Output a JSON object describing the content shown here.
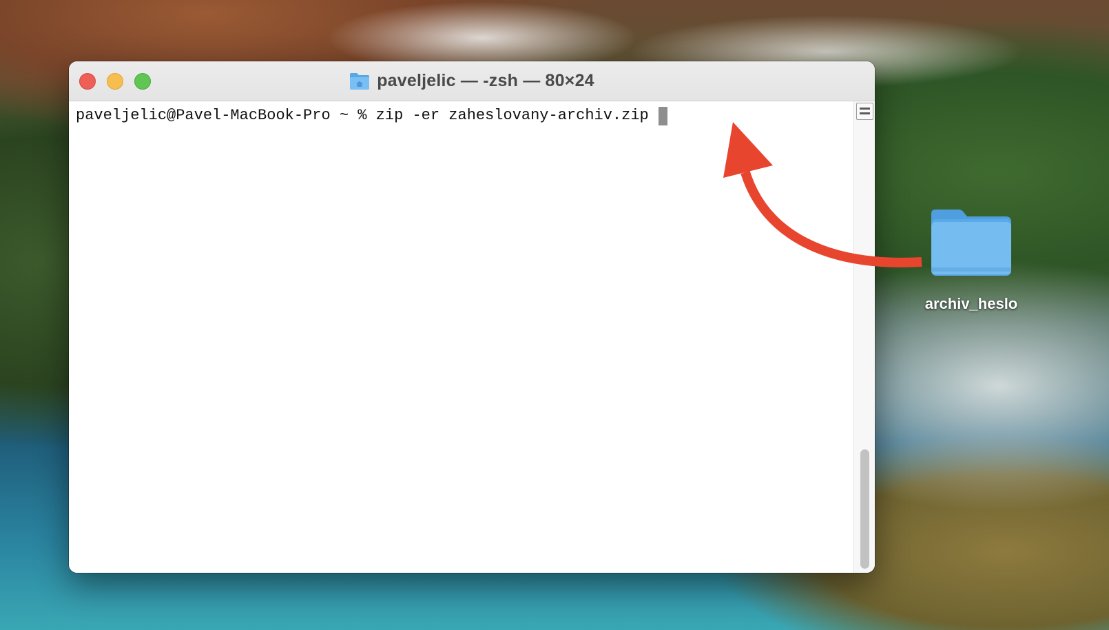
{
  "window": {
    "title": "paveljelic — -zsh — 80×24",
    "title_icon": "home-folder-icon",
    "buttons": {
      "close": "close-button",
      "minimize": "minimize-button",
      "zoom": "zoom-button"
    }
  },
  "terminal": {
    "prompt": "paveljelic@Pavel-MacBook-Pro ~ % ",
    "command": "zip -er zaheslovany-archiv.zip"
  },
  "desktop": {
    "folder": {
      "label": "archiv_heslo",
      "icon": "folder-icon"
    },
    "annotation": {
      "type": "curved-arrow",
      "color": "#e8452f"
    }
  },
  "colors": {
    "close": "#ed5f57",
    "minimize": "#f6be4f",
    "zoom": "#61c554",
    "folder": "#6cb5ee",
    "arrow": "#e8452f"
  }
}
